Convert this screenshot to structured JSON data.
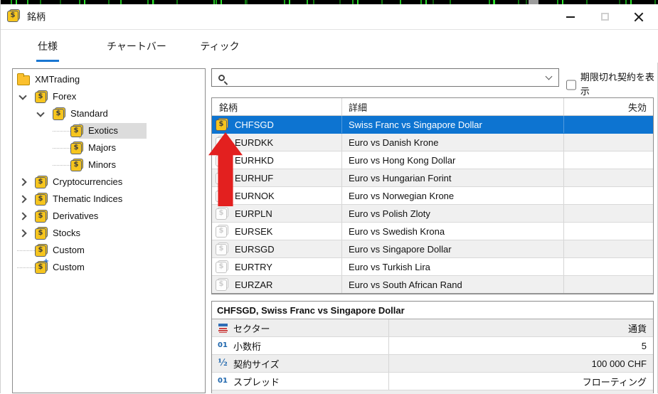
{
  "window": {
    "title": "銘柄"
  },
  "tabs": [
    {
      "label": "仕様"
    },
    {
      "label": "チャートバー"
    },
    {
      "label": "ティック"
    }
  ],
  "search": {
    "value": "",
    "placeholder": ""
  },
  "filters": {
    "show_expired_label": "期限切れ契約を表示"
  },
  "tree": [
    {
      "label": "XMTrading"
    },
    {
      "label": "Forex"
    },
    {
      "label": "Standard"
    },
    {
      "label": "Exotics"
    },
    {
      "label": "Majors"
    },
    {
      "label": "Minors"
    },
    {
      "label": "Cryptocurrencies"
    },
    {
      "label": "Thematic Indices"
    },
    {
      "label": "Derivatives"
    },
    {
      "label": "Stocks"
    },
    {
      "label": "Custom"
    },
    {
      "label": "Custom"
    }
  ],
  "table": {
    "columns": {
      "symbol": "銘柄",
      "detail": "詳細",
      "expiry": "失効"
    },
    "rows": [
      {
        "symbol": "CHFSGD",
        "detail": "Swiss Franc vs Singapore Dollar",
        "expiry": ""
      },
      {
        "symbol": "EURDKK",
        "detail": "Euro vs Danish Krone",
        "expiry": ""
      },
      {
        "symbol": "EURHKD",
        "detail": "Euro vs Hong Kong Dollar",
        "expiry": ""
      },
      {
        "symbol": "EURHUF",
        "detail": "Euro vs Hungarian Forint",
        "expiry": ""
      },
      {
        "symbol": "EURNOK",
        "detail": "Euro vs Norwegian Krone",
        "expiry": ""
      },
      {
        "symbol": "EURPLN",
        "detail": "Euro vs Polish Zloty",
        "expiry": ""
      },
      {
        "symbol": "EURSEK",
        "detail": "Euro vs Swedish Krona",
        "expiry": ""
      },
      {
        "symbol": "EURSGD",
        "detail": "Euro vs Singapore Dollar",
        "expiry": ""
      },
      {
        "symbol": "EURTRY",
        "detail": "Euro vs Turkish Lira",
        "expiry": ""
      },
      {
        "symbol": "EURZAR",
        "detail": "Euro vs South African Rand",
        "expiry": ""
      }
    ]
  },
  "details": {
    "title": "CHFSGD, Swiss Franc vs Singapore Dollar",
    "rows": [
      {
        "label": "セクター",
        "value": "通貨"
      },
      {
        "label": "小数桁",
        "value": "5"
      },
      {
        "label": "契約サイズ",
        "value": "100 000 CHF"
      },
      {
        "label": "スプレッド",
        "value": "フローティング"
      }
    ]
  }
}
